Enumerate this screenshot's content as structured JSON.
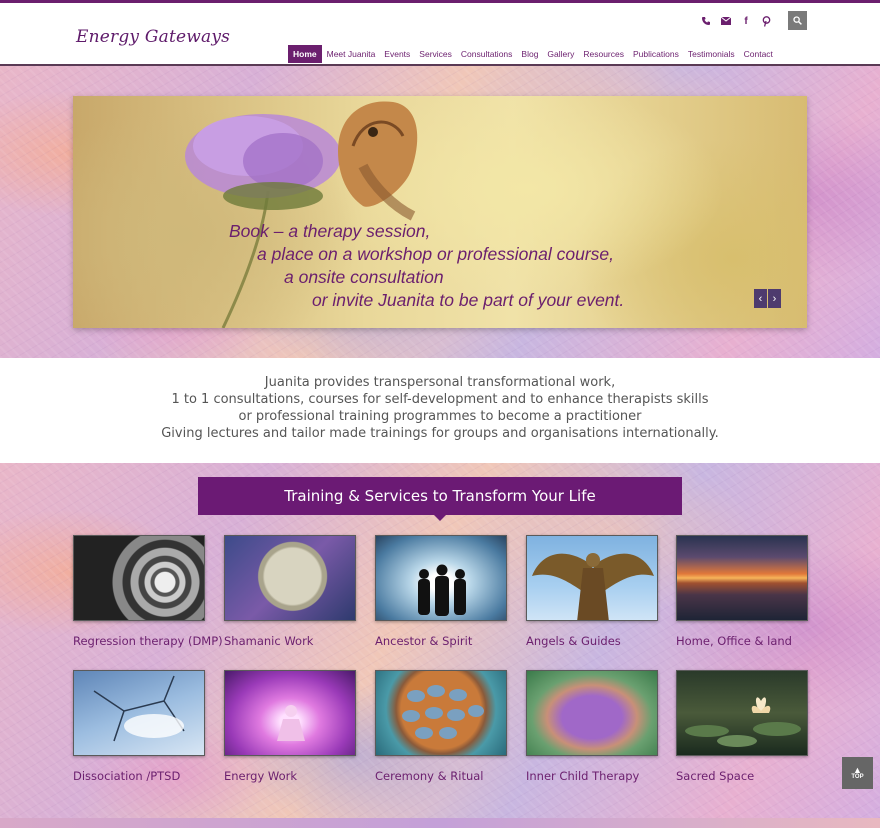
{
  "header": {
    "logo": "Energy Gateways",
    "social_icons": [
      "phone-icon",
      "mail-icon",
      "facebook-icon",
      "pinterest-icon"
    ],
    "search_icon": "search-icon",
    "nav": [
      {
        "label": "Home",
        "active": true
      },
      {
        "label": "Meet Juanita"
      },
      {
        "label": "Events"
      },
      {
        "label": "Services"
      },
      {
        "label": "Consultations"
      },
      {
        "label": "Blog"
      },
      {
        "label": "Gallery"
      },
      {
        "label": "Resources"
      },
      {
        "label": "Publications"
      },
      {
        "label": "Testimonials"
      },
      {
        "label": "Contact"
      }
    ]
  },
  "hero": {
    "lines": [
      "Book – a therapy session,",
      "a place on a workshop or professional course,",
      "a onsite consultation",
      "or invite Juanita to be part of your event."
    ],
    "prev_icon": "chevron-left-icon",
    "next_icon": "chevron-right-icon"
  },
  "intro": {
    "lines": [
      "Juanita provides transpersonal transformational work,",
      "1 to 1 consultations, courses for self-development and to enhance therapists skills",
      "or professional training programmes to become a practitioner",
      "Giving lectures and tailor made trainings for groups and organisations internationally."
    ]
  },
  "services": {
    "title": "Training & Services to Transform Your Life",
    "items": [
      {
        "label": "Regression therapy (DMP)"
      },
      {
        "label": "Shamanic Work"
      },
      {
        "label": "Ancestor & Spirit"
      },
      {
        "label": "Angels & Guides"
      },
      {
        "label": "Home, Office & land"
      },
      {
        "label": "Dissociation /PTSD"
      },
      {
        "label": "Energy Work"
      },
      {
        "label": "Ceremony & Ritual"
      },
      {
        "label": "Inner Child Therapy"
      },
      {
        "label": "Sacred Space"
      }
    ]
  },
  "scroll_top": {
    "label": "TOP",
    "icon": "arrow-up-icon"
  },
  "colors": {
    "accent": "#6b1f6e",
    "title_bar": "#6b1a74"
  }
}
